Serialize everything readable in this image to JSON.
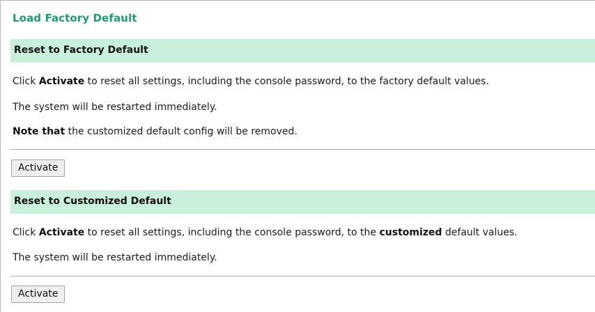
{
  "page": {
    "title": "Load Factory Default"
  },
  "factory": {
    "header": "Reset to Factory Default",
    "desc_prefix": "Click ",
    "desc_bold": "Activate",
    "desc_suffix": " to reset all settings, including the console password, to the factory default values.",
    "restart": "The system will be restarted immediately.",
    "note_bold": "Note that",
    "note_text": " the customized default config will be removed.",
    "button": "Activate"
  },
  "customized": {
    "header": "Reset to Customized Default",
    "desc_prefix": "Click ",
    "desc_bold": "Activate",
    "desc_middle": " to reset all settings, including the console password, to the ",
    "desc_bold2": "customized",
    "desc_suffix": " default values.",
    "restart": "The system will be restarted immediately.",
    "button": "Activate"
  }
}
